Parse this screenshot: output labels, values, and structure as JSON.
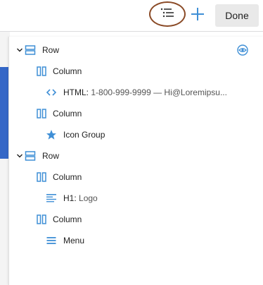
{
  "toolbar": {
    "list_view_icon": "list-view-icon",
    "add_icon": "plus-icon",
    "done_label": "Done"
  },
  "colors": {
    "accent": "#3f8fd6",
    "highlight_ring": "#8a4a26",
    "canvas_block": "#3467c7"
  },
  "tree": {
    "row1": {
      "label": "Row",
      "icon": "row-icon"
    },
    "row1_col1": {
      "label": "Column",
      "icon": "column-icon"
    },
    "row1_col1_html": {
      "prefix": "HTML: ",
      "desc": "1-800-999-9999 — Hi@Loremipsu...",
      "icon": "code-icon"
    },
    "row1_col2": {
      "label": "Column",
      "icon": "column-icon"
    },
    "row1_col2_icongroup": {
      "label": "Icon Group",
      "icon": "star-icon"
    },
    "row2": {
      "label": "Row",
      "icon": "row-icon"
    },
    "row2_col1": {
      "label": "Column",
      "icon": "column-icon"
    },
    "row2_col1_h1": {
      "prefix": "H1: ",
      "desc": "Logo",
      "icon": "heading-icon"
    },
    "row2_col2": {
      "label": "Column",
      "icon": "column-icon"
    },
    "row2_col2_menu": {
      "label": "Menu",
      "icon": "menu-icon"
    }
  }
}
